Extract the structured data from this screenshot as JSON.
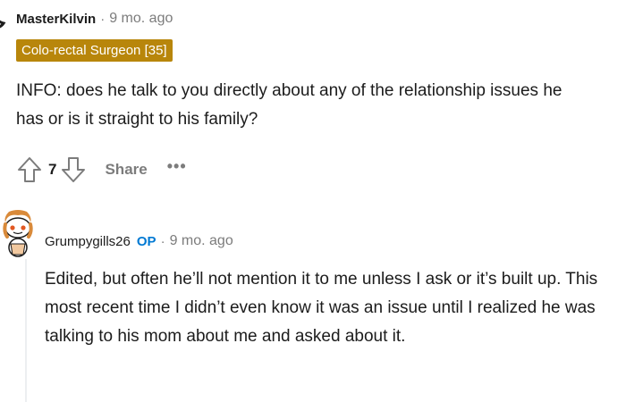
{
  "comment": {
    "author": "MasterKilvin",
    "separator": "·",
    "time": "9 mo. ago",
    "flair": "Colo-rectal Surgeon [35]",
    "body": "INFO: does he talk to you directly about any of the relationship issues he has or is it straight to his family?",
    "vote_count": "7",
    "share_label": "Share",
    "more_label": "•••"
  },
  "reply": {
    "author": "Grumpygills26",
    "op_badge": "OP",
    "separator": "·",
    "time": "9 mo. ago",
    "body": "Edited, but often he’ll not mention it to me unless I ask or it’s built up. This most recent time I didn’t even know it was an issue until I realized he was talking to his mom about me and asked about it."
  },
  "colors": {
    "flair_bg": "#b8860b",
    "op_blue": "#0079d3",
    "meta_gray": "#7c7c7c"
  },
  "icons": {
    "upvote": "upvote-icon",
    "downvote": "downvote-icon",
    "avatar_1": "avatar",
    "avatar_2": "avatar"
  }
}
